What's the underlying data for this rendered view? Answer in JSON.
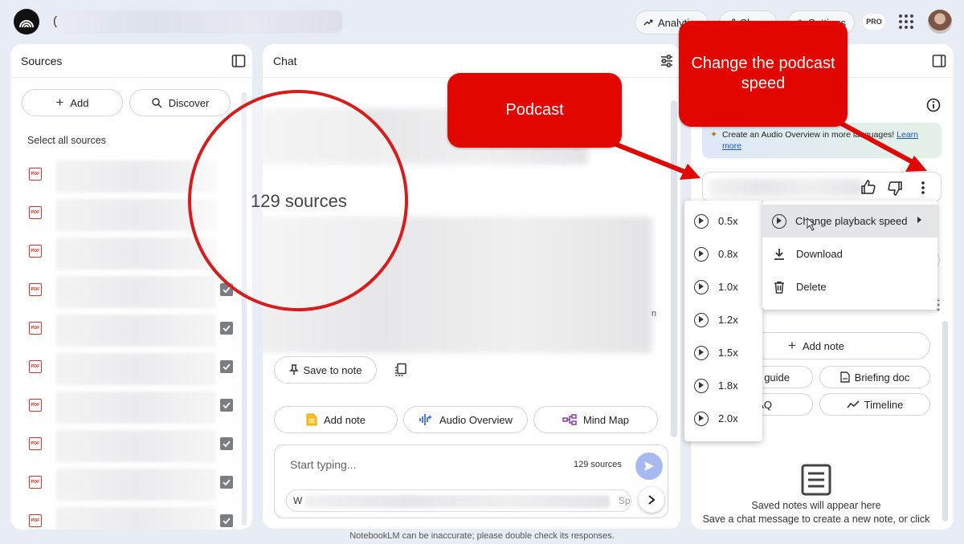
{
  "topbar": {
    "title_visible_char": "(",
    "analytics_label": "Analytics",
    "share_label": "Share",
    "settings_label": "Settings",
    "pro_badge": "PRO"
  },
  "sources": {
    "title": "Sources",
    "add_label": "Add",
    "discover_label": "Discover",
    "select_all_label": "Select all sources",
    "pdf_badge": "PDF"
  },
  "chat": {
    "title": "Chat",
    "source_count": "129 sources",
    "save_to_note_label": "Save to note",
    "add_note_label": "Add note",
    "audio_overview_label": "Audio Overview",
    "mind_map_label": "Mind Map",
    "input_placeholder": "Start typing...",
    "input_source_count": "129 sources",
    "suggestion_start": "W",
    "suggestion_end": "Spa",
    "trailing_char": "n"
  },
  "studio": {
    "audio_banner_text": "Create an Audio Overview in more languages!",
    "audio_banner_link": "Learn more",
    "add_note_label": "Add note",
    "study_guide_label": "y guide",
    "briefing_doc_label": "Briefing doc",
    "faq_label": "AQ",
    "timeline_label": "Timeline",
    "empty_title": "Saved notes will appear here",
    "empty_desc": "Save a chat message to create a new note, or click"
  },
  "context_menu": {
    "change_speed_label": "Change playback speed",
    "download_label": "Download",
    "delete_label": "Delete"
  },
  "speed_menu": {
    "options": [
      "0.5x",
      "0.8x",
      "1.0x",
      "1.2x",
      "1.5x",
      "1.8x",
      "2.0x"
    ]
  },
  "callouts": {
    "podcast": "Podcast",
    "change_speed": "Change the podcast speed"
  },
  "footer": {
    "disclaimer": "NotebookLM can be inaccurate; please double check its responses."
  },
  "colors": {
    "callout_red": "#e10600",
    "circle_red": "#d81b1b",
    "pdf_red": "#d93025",
    "send_blue": "#a8b8f0"
  }
}
